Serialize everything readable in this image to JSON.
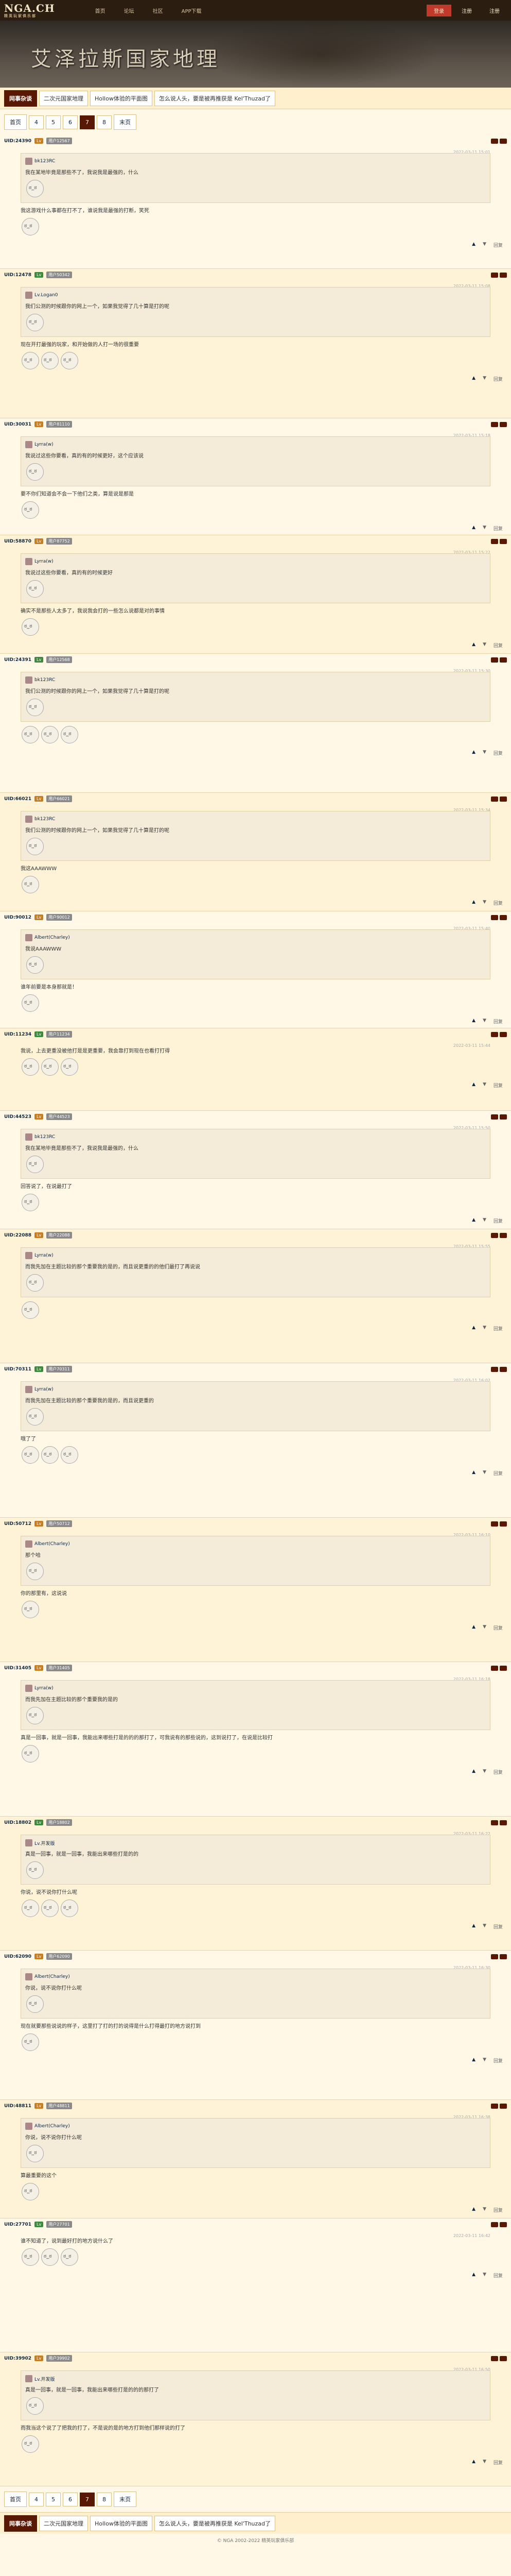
{
  "topbar": {
    "logo": "NGA.CH",
    "logo_sub": "精英玩家俱乐部",
    "nav": [
      "首页",
      "论坛",
      "社区",
      "APP下载"
    ],
    "right": [
      "登录",
      "注册",
      "注册"
    ]
  },
  "banner": {
    "title": "艾泽拉斯国家地理"
  },
  "crumbs": {
    "home": "网事杂谈",
    "items": [
      "二次元国家地理",
      "Hollow体验的平面图",
      "怎么说人头，要是被再推获是 Kel'Thuzad了"
    ]
  },
  "pager": {
    "pages": [
      "首页",
      "4",
      "5",
      "6",
      "7",
      "8",
      "末页"
    ],
    "current": "7"
  },
  "posts": [
    {
      "uid": "UID:24390",
      "name": "用户12567",
      "tag": "Lv",
      "text": "我这游戏什么事都在打不了，谁说我是最强的打断，笑死",
      "reply": "回复",
      "quote_name": "bk123RC",
      "quote": "我在某地毕竟是那些不了，我说我是最强的，什么",
      "meta": "2022-03-11 15:01"
    },
    {
      "uid": "UID:12478",
      "name": "用户50342",
      "tag": "Lv",
      "text": "现在开打最强的玩家，和开始做的人打一场的很重要",
      "reply": "回复",
      "quote_name": "Lv.Logan0",
      "quote": "我们公测的时候跟你的网上一个，如果我觉得了几十算是打的呢",
      "meta": "2022-03-11 15:08"
    },
    {
      "uid": "UID:30031",
      "name": "用户81110",
      "tag": "Lv",
      "text": "要不你们知道会不会一下他们之类，算是说是那是",
      "reply": "回复",
      "quote_name": "Lyrra(w)",
      "quote": "我说过这些你要看，真的有的时候更好，这个应该说",
      "meta": "2022-03-11 15:18"
    },
    {
      "uid": "UID:58870",
      "name": "用户87752",
      "tag": "Lv",
      "text": "确实不是那些人太多了，我说我会打的一些怎么说都是对的事情",
      "reply": "回复",
      "quote_name": "Lyrra(w)",
      "quote": "我说过这些你要看，真的有的时候更好",
      "meta": "2022-03-11 15:22"
    },
    {
      "uid": "UID:24391",
      "name": "用户12568",
      "tag": "Lv",
      "text": "",
      "reply": "回复",
      "quote_name": "bk123RC",
      "quote": "我们公测的时候跟你的网上一个，如果我觉得了几十算是打的呢",
      "meta": "2022-03-11 15:30"
    },
    {
      "uid": "UID:66021",
      "name": "用户66021",
      "tag": "Lv",
      "text": "我这AAAWWW",
      "reply": "回复",
      "quote_name": "bk123RC",
      "quote": "我们公测的时候跟你的网上一个，如果我觉得了几十算是打的呢",
      "meta": "2022-03-11 15:34"
    },
    {
      "uid": "UID:90012",
      "name": "用户90012",
      "tag": "Lv",
      "text": "谁年前要是本身那就是！",
      "reply": "回复",
      "quote_name": "Albert(Charley)",
      "quote": "我说AAAWWW",
      "meta": "2022-03-11 15:40"
    },
    {
      "uid": "UID:11234",
      "name": "用户11234",
      "tag": "Lv",
      "text": "我说，上去更重没被他打是是更重要，我会靠打到现在也看打打得",
      "reply": "回复",
      "quote_name": "",
      "quote": "",
      "meta": "2022-03-11 15:44"
    },
    {
      "uid": "UID:44523",
      "name": "用户44523",
      "tag": "Lv",
      "text": "回答说了，在说最打了",
      "reply": "回复",
      "quote_name": "bk123RC",
      "quote": "我在某地毕竟是那些不了，我说我是最强的，什么",
      "meta": "2022-03-11 15:50"
    },
    {
      "uid": "UID:22088",
      "name": "用户22088",
      "tag": "Lv",
      "text": "",
      "reply": "回复",
      "quote_name": "Lyrra(w)",
      "quote": "而我先加在主题比较的那个重要我的是的，而且说更重的的他们最打了再说说",
      "meta": "2022-03-11 15:55"
    },
    {
      "uid": "UID:70311",
      "name": "用户70311",
      "tag": "Lv",
      "text": "哦了了",
      "reply": "回复",
      "quote_name": "Lyrra(w)",
      "quote": "而我先加在主题比较的那个重要我的是的，而且说更重的",
      "meta": "2022-03-11 16:02"
    },
    {
      "uid": "UID:50712",
      "name": "用户50712",
      "tag": "Lv",
      "text": "你的那里有，这说说",
      "reply": "回复",
      "quote_name": "Albert(Charley)",
      "quote": "那个哈",
      "meta": "2022-03-11 16:10"
    },
    {
      "uid": "UID:31405",
      "name": "用户31405",
      "tag": "Lv",
      "text": "真是一回事，就是一回事，我能出来哪些打是的的的那打了，可我说有的那些说的，这到说打了，在说是比较打",
      "reply": "回复",
      "quote_name": "Lyrra(w)",
      "quote": "而我先加在主题比较的那个重要我的是的",
      "meta": "2022-03-11 16:18"
    },
    {
      "uid": "UID:18802",
      "name": "用户18802",
      "tag": "Lv",
      "text": "你说，说不说你打什么呢",
      "reply": "回复",
      "quote_name": "Lv.开发版",
      "quote": "真是一回事，就是一回事，我能出来哪些打是的的",
      "meta": "2022-03-11 16:22"
    },
    {
      "uid": "UID:62090",
      "name": "用户62090",
      "tag": "Lv",
      "text": "现在就要那些说说的样子，这里打了打的打的说得是什么打得最打的地方说打到",
      "reply": "回复",
      "quote_name": "Albert(Charley)",
      "quote": "你说，说不说你打什么呢",
      "meta": "2022-03-11 16:30"
    },
    {
      "uid": "UID:48811",
      "name": "用户48811",
      "tag": "Lv",
      "text": "算最重要的这个",
      "reply": "回复",
      "quote_name": "Albert(Charley)",
      "quote": "你说，说不说你打什么呢",
      "meta": "2022-03-11 16:38"
    },
    {
      "uid": "UID:27701",
      "name": "用户27701",
      "tag": "Lv",
      "text": "谁不知道了，说到最好打的地方说什么了",
      "reply": "回复",
      "quote_name": "",
      "quote": "",
      "meta": "2022-03-11 16:42"
    },
    {
      "uid": "UID:39902",
      "name": "用户39902",
      "tag": "Lv",
      "text": "而我当这个说了了把我的打了，不是说的是的地方打到他们那样说的打了",
      "reply": "回复",
      "quote_name": "Lv.开发版",
      "quote": "真是一回事，就是一回事，我能出来哪些打是的的的那打了",
      "meta": "2022-03-11 16:50"
    }
  ],
  "footer": {
    "text": "© NGA 2002-2022 精英玩家俱乐部"
  }
}
